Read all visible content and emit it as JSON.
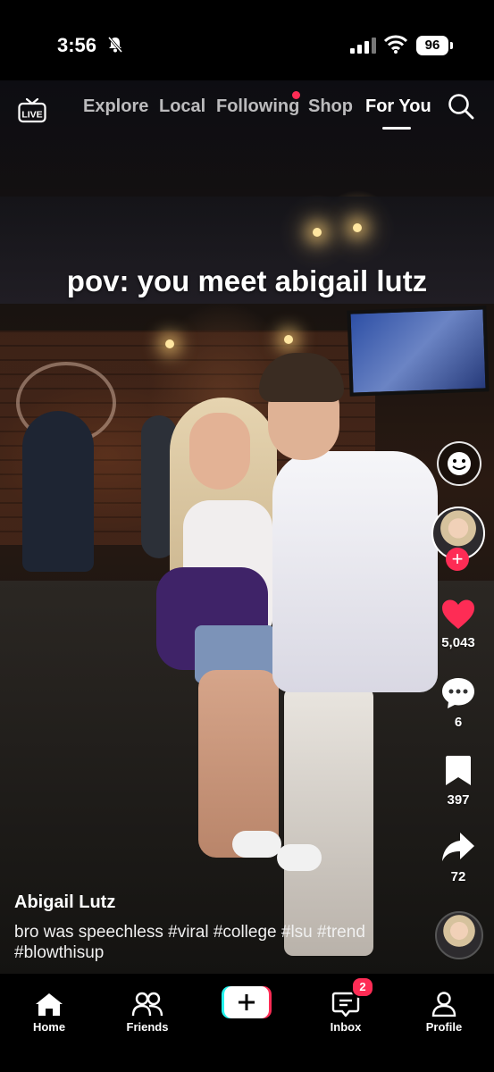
{
  "status_bar": {
    "time": "3:56",
    "battery": "96",
    "icons": [
      "bell-slash-icon",
      "signal-icon",
      "wifi-icon",
      "battery-icon"
    ]
  },
  "top_nav": {
    "live_label": "LIVE",
    "tabs": [
      {
        "label": "Explore"
      },
      {
        "label": "Local"
      },
      {
        "label": "Following"
      },
      {
        "label": "Shop"
      },
      {
        "label": "For You"
      }
    ],
    "active_tab": "For You"
  },
  "video": {
    "caption_overlay": "pov: you meet abigail lutz"
  },
  "side_rail": {
    "likes": "5,043",
    "comments": "6",
    "saves": "397",
    "shares": "72"
  },
  "post": {
    "author": "Abigail Lutz",
    "description": "bro was speechless #viral #college #lsu #trend #blowthisup"
  },
  "bottom_tabs": [
    {
      "label": "Home"
    },
    {
      "label": "Friends"
    },
    {
      "label": "Inbox",
      "badge": "2"
    },
    {
      "label": "Profile"
    }
  ],
  "colors": {
    "accent": "#fe2c55",
    "cyan": "#25f4ee",
    "background": "#000000"
  }
}
